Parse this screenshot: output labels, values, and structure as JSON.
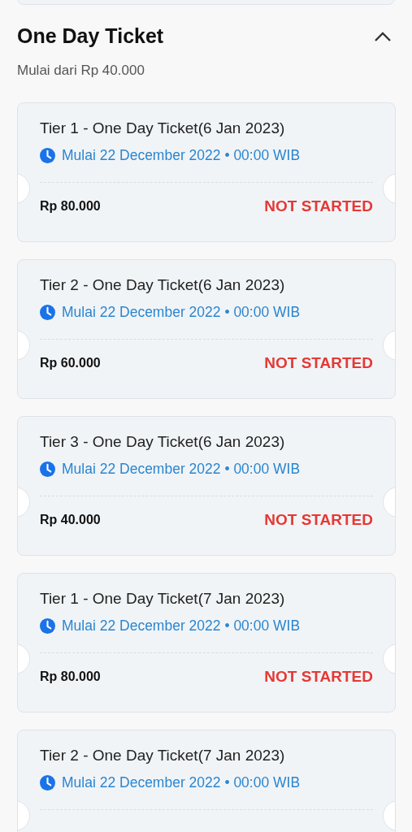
{
  "section": {
    "title": "One Day Ticket",
    "expanded": true,
    "subtitle": "Mulai dari Rp 40.000"
  },
  "tickets": [
    {
      "name": "Tier 1 - One Day Ticket(6 Jan 2023)",
      "start": "Mulai 22 December 2022 • 00:00 WIB",
      "price": "Rp 80.000",
      "status": "NOT STARTED"
    },
    {
      "name": "Tier 2 - One Day Ticket(6 Jan 2023)",
      "start": "Mulai 22 December 2022 • 00:00 WIB",
      "price": "Rp 60.000",
      "status": "NOT STARTED"
    },
    {
      "name": "Tier 3 - One Day Ticket(6 Jan 2023)",
      "start": "Mulai 22 December 2022 • 00:00 WIB",
      "price": "Rp 40.000",
      "status": "NOT STARTED"
    },
    {
      "name": "Tier 1 - One Day Ticket(7 Jan 2023)",
      "start": "Mulai 22 December 2022 • 00:00 WIB",
      "price": "Rp 80.000",
      "status": "NOT STARTED"
    },
    {
      "name": "Tier 2 - One Day Ticket(7 Jan 2023)",
      "start": "Mulai 22 December 2022 • 00:00 WIB"
    }
  ]
}
